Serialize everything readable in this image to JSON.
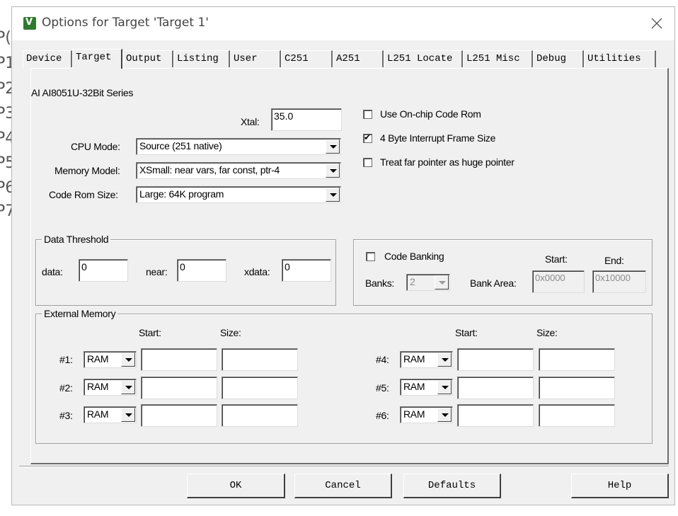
{
  "background_chars": [
    "P(",
    "P1",
    "P2",
    "P3",
    "P4",
    "P5",
    "P6",
    "P7"
  ],
  "window": {
    "title": "Options for Target 'Target 1'"
  },
  "tabs": [
    {
      "label": "Device"
    },
    {
      "label": "Target",
      "active": true
    },
    {
      "label": "Output"
    },
    {
      "label": "Listing"
    },
    {
      "label": "User"
    },
    {
      "label": "C251"
    },
    {
      "label": "A251"
    },
    {
      "label": "L251 Locate"
    },
    {
      "label": "L251 Misc"
    },
    {
      "label": "Debug"
    },
    {
      "label": "Utilities"
    }
  ],
  "target": {
    "device_name": "AI AI8051U-32Bit Series",
    "xtal_label": "Xtal:",
    "xtal_value": "35.0",
    "cpu_mode_label": "CPU Mode:",
    "cpu_mode_value": "Source (251 native)",
    "memory_model_label": "Memory Model:",
    "memory_model_value": "XSmall: near vars, far const, ptr-4",
    "code_rom_size_label": "Code Rom Size:",
    "code_rom_size_value": "Large: 64K program",
    "use_onchip_code_rom": {
      "label": "Use On-chip Code Rom",
      "checked": false
    },
    "four_byte_interrupt": {
      "label": "4 Byte Interrupt Frame Size",
      "checked": true
    },
    "far_as_huge": {
      "label": "Treat far pointer as huge pointer",
      "checked": false
    }
  },
  "data_threshold": {
    "title": "Data Threshold",
    "data_label": "data:",
    "data_value": "0",
    "near_label": "near:",
    "near_value": "0",
    "xdata_label": "xdata:",
    "xdata_value": "0"
  },
  "code_banking": {
    "label": "Code Banking",
    "checked": false,
    "start_label": "Start:",
    "end_label": "End:",
    "banks_label": "Banks:",
    "banks_value": "2",
    "bank_area_label": "Bank Area:",
    "start_value": "0x0000",
    "end_value": "0x10000"
  },
  "external_memory": {
    "title": "External Memory",
    "start_header": "Start:",
    "size_header": "Size:",
    "rows": [
      {
        "label": "#1:",
        "type": "RAM",
        "start": "",
        "size": ""
      },
      {
        "label": "#2:",
        "type": "RAM",
        "start": "",
        "size": ""
      },
      {
        "label": "#3:",
        "type": "RAM",
        "start": "",
        "size": ""
      },
      {
        "label": "#4:",
        "type": "RAM",
        "start": "",
        "size": ""
      },
      {
        "label": "#5:",
        "type": "RAM",
        "start": "",
        "size": ""
      },
      {
        "label": "#6:",
        "type": "RAM",
        "start": "",
        "size": ""
      }
    ]
  },
  "buttons": {
    "ok": "OK",
    "cancel": "Cancel",
    "defaults": "Defaults",
    "help": "Help"
  }
}
